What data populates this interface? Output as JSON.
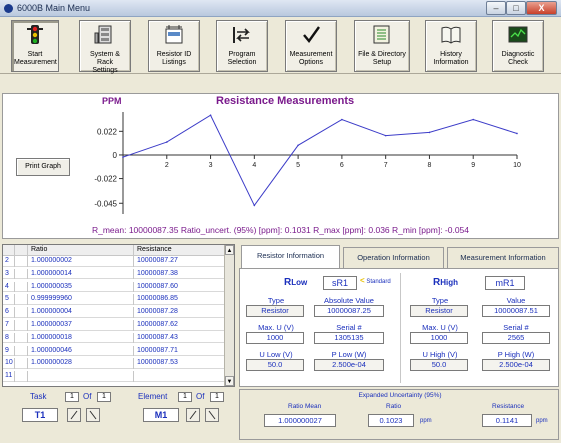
{
  "window": {
    "title": "6000B Main Menu",
    "min": "–",
    "max": "□",
    "close": "X"
  },
  "toolbar": [
    {
      "label": "Start\nMeasurement",
      "icon": "traffic-light-icon"
    },
    {
      "label": "System & Rack\nSettings",
      "icon": "rack-icon"
    },
    {
      "label": "Resistor ID\nListings",
      "icon": "resistor-id-icon"
    },
    {
      "label": "Program\nSelection",
      "icon": "program-selection-icon"
    },
    {
      "label": "Measurement\nOptions",
      "icon": "checkmark-icon"
    },
    {
      "label": "File & Directory\nSetup",
      "icon": "file-directory-icon"
    },
    {
      "label": "History\nInformation",
      "icon": "book-icon"
    },
    {
      "label": "Diagnostic\nCheck",
      "icon": "diagnostic-icon"
    }
  ],
  "graph": {
    "unit_label": "PPM",
    "title": "Resistance Measurements",
    "print_button": "Print Graph",
    "stats_text": "R_mean: 10000087.35   Ratio_uncert. (95%) [ppm]: 0.1031   R_max [ppm]: 0.036   R_min [ppm]: -0.054",
    "line_color": "#3c3cc8",
    "text_color": "#7a1a8c"
  },
  "chart_data": {
    "type": "line",
    "x": [
      1,
      2,
      3,
      4,
      5,
      6,
      7,
      8,
      9,
      10
    ],
    "series": [
      {
        "values": [
          -0.002,
          0.012,
          0.037,
          -0.047,
          0.009,
          0.033,
          0.018,
          0.021,
          0.033,
          0.02
        ]
      }
    ],
    "yticks": [
      "0.022",
      "0",
      "-0.022",
      "-0.045"
    ],
    "xticks": [
      "2",
      "3",
      "4",
      "5",
      "6",
      "7",
      "8",
      "9",
      "10"
    ],
    "ylim": [
      -0.055,
      0.04
    ],
    "xlim": [
      1,
      10
    ],
    "title": "Resistance Measurements",
    "ylabel": "PPM",
    "xlabel": ""
  },
  "table": {
    "headers": [
      "Ratio",
      "Resistance"
    ],
    "rows": [
      {
        "n": "2",
        "ratio": "1.000000002",
        "resistance": "10000087.27"
      },
      {
        "n": "3",
        "ratio": "1.000000014",
        "resistance": "10000087.38"
      },
      {
        "n": "4",
        "ratio": "1.000000035",
        "resistance": "10000087.60"
      },
      {
        "n": "5",
        "ratio": "0.999999960",
        "resistance": "10000086.85"
      },
      {
        "n": "6",
        "ratio": "1.000000004",
        "resistance": "10000087.28"
      },
      {
        "n": "7",
        "ratio": "1.000000037",
        "resistance": "10000087.62"
      },
      {
        "n": "8",
        "ratio": "1.000000018",
        "resistance": "10000087.43"
      },
      {
        "n": "9",
        "ratio": "1.000000046",
        "resistance": "10000087.71"
      },
      {
        "n": "10",
        "ratio": "1.000000028",
        "resistance": "10000087.53"
      },
      {
        "n": "11",
        "ratio": "",
        "resistance": ""
      }
    ]
  },
  "task": {
    "label": "Task",
    "index": "1",
    "of": "Of",
    "total": "1",
    "id": "T1"
  },
  "element": {
    "label": "Element",
    "index": "1",
    "of": "Of",
    "total": "1",
    "id": "M1"
  },
  "tabs": [
    "Resistor Information",
    "Operation Information",
    "Measurement Information"
  ],
  "rlow": {
    "label": "R",
    "sub": "Low",
    "id": "sR1",
    "standard": "Standard",
    "type_label": "Type",
    "type_value": "Resistor",
    "abs_label": "Absolute Value",
    "abs_value": "10000087.25",
    "maxu_label": "Max. U  (V)",
    "maxu_value": "1000",
    "serial_label": "Serial #",
    "serial_value": "1305135",
    "ulow_label": "U Low (V)",
    "ulow_value": "50.0",
    "plow_label": "P Low (W)",
    "plow_value": "2.500e-04"
  },
  "rhigh": {
    "label": "R",
    "sub": "High",
    "id": "mR1",
    "type_label": "Type",
    "type_value": "Resistor",
    "value_label": "Value",
    "value_value": "10000087.51",
    "maxu_label": "Max. U  (V)",
    "maxu_value": "1000",
    "serial_label": "Serial #",
    "serial_value": "2565",
    "uhigh_label": "U High (V)",
    "uhigh_value": "50.0",
    "phigh_label": "P High (W)",
    "phigh_value": "2.500e-04"
  },
  "uncertainty": {
    "title": "Expanded Uncertainty (95%)",
    "ratio_mean_label": "Ratio Mean",
    "ratio_mean_value": "1.000000027",
    "ratio_label": "Ratio",
    "ratio_value": "0.1023",
    "ratio_unit": "ppm",
    "res_label": "Resistance",
    "res_value": "0.1141",
    "res_unit": "ppm"
  }
}
